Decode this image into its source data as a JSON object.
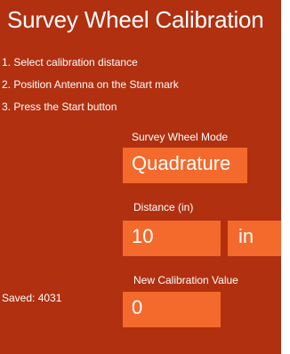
{
  "header": {
    "title": "Survey Wheel Calibration"
  },
  "instructions": [
    "1. Select calibration distance",
    "2. Position Antenna on the Start mark",
    "3. Press the Start button"
  ],
  "mode": {
    "label": "Survey Wheel Mode",
    "value": "Quadrature"
  },
  "distance": {
    "label": "Distance (in)",
    "value": "10",
    "unit": "in"
  },
  "calibration": {
    "label": "New Calibration Value",
    "value": "0",
    "saved_text": "Saved: 4031"
  },
  "colors": {
    "background": "#b03010",
    "field": "#f36a2c",
    "text": "#ffffff"
  }
}
